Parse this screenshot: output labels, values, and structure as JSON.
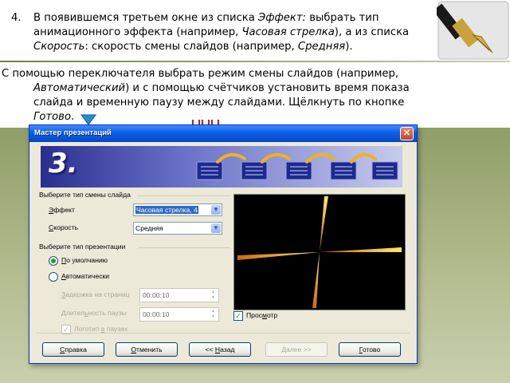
{
  "slide": {
    "item_number": "4.",
    "line1_a": "В появившемся третьем окне из списка ",
    "line1_effect": "Эффект:",
    "line1_b": " выбрать тип",
    "line2_a": "анимационного эффекта (например, ",
    "line2_clock": "Часовая стрелка",
    "line2_b": "), а из списка",
    "line3_speed": "Скорость",
    "line3_a": ": скорость смены слайдов (например, ",
    "line3_medium": "Средняя",
    "line3_b": ").",
    "para_line1": "С помощью переключателя выбрать режим  смены слайдов (например,",
    "para_line2_auto": "Автоматический",
    "para_line2_b": ") и с помощью счётчиков установить  время показа",
    "para_line3": "слайда  и временную паузу между слайдами. Щёлкнуть по кнопке",
    "para_line4_done": "Готово",
    "para_line4_b": "."
  },
  "dialog": {
    "title": "Мастер презентаций",
    "close_glyph": "✕",
    "step_number": "3.",
    "transition_group": "Выберите тип смены слайда",
    "effect_label": {
      "first": "Э",
      "rest": "ффект"
    },
    "effect_value": "Часовая стрелка, 4",
    "speed_label": {
      "first": "С",
      "rest": "корость"
    },
    "speed_value": "Средняя",
    "presentation_group": "Выберите тип презентации",
    "default_radio": {
      "first": "П",
      "rest": "о умолчанию"
    },
    "auto_radio": {
      "first": "А",
      "rest": "втоматически"
    },
    "delay_label": {
      "first": "З",
      "rest": "адержка на страниц"
    },
    "delay_value": "00:00:10",
    "pause_label": {
      "pre": "Длител",
      "u": "ь",
      "post": "ность паузы"
    },
    "pause_value": "00:00:10",
    "logo_label": {
      "pre": "Логотип ",
      "u": "в",
      "post": " паузах"
    },
    "preview_label": {
      "pre": "Прос",
      "u": "м",
      "post": "отр"
    },
    "buttons": {
      "help": {
        "first": "С",
        "rest": "правка"
      },
      "cancel": {
        "first": "О",
        "rest": "тменить"
      },
      "back": {
        "pre": "<< ",
        "u": "Н",
        "post": "азад"
      },
      "next": "Далее >>",
      "finish": {
        "first": "Г",
        "rest": "отово"
      }
    }
  }
}
